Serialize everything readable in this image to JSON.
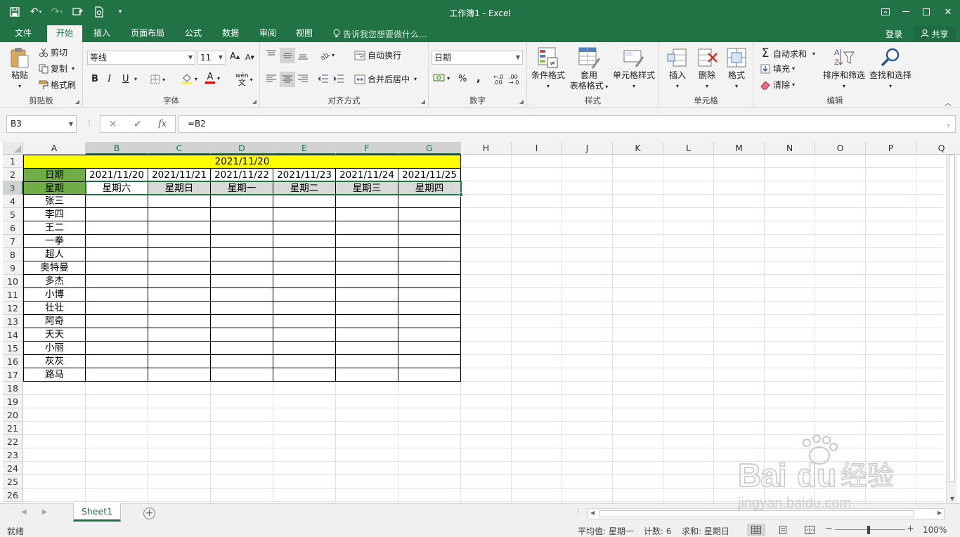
{
  "window": {
    "title": "工作簿1 - Excel"
  },
  "ribbon_tabs": [
    {
      "label": "文件"
    },
    {
      "label": "开始"
    },
    {
      "label": "插入"
    },
    {
      "label": "页面布局"
    },
    {
      "label": "公式"
    },
    {
      "label": "数据"
    },
    {
      "label": "审阅"
    },
    {
      "label": "视图"
    }
  ],
  "tell_me": "告诉我您想要做什么...",
  "account": {
    "login": "登录",
    "share": "共享"
  },
  "clipboard": {
    "paste": "粘贴",
    "cut": "剪切",
    "copy": "复制",
    "format_painter": "格式刷",
    "group_label": "剪贴板"
  },
  "font": {
    "name": "等线",
    "size": "11",
    "bold": "B",
    "italic": "I",
    "underline": "U",
    "group_label": "字体"
  },
  "alignment": {
    "wrap_text": "自动换行",
    "merge_center": "合并后居中",
    "group_label": "对齐方式"
  },
  "number": {
    "format": "日期",
    "percent": "%",
    "comma": ",",
    "group_label": "数字"
  },
  "styles": {
    "conditional": "条件格式",
    "as_table_1": "套用",
    "as_table_2": "表格格式",
    "cell_styles": "单元格样式",
    "group_label": "样式"
  },
  "cells": {
    "insert": "插入",
    "delete": "删除",
    "format": "格式",
    "group_label": "单元格"
  },
  "editing": {
    "autosum": "自动求和",
    "fill": "填充",
    "clear": "清除",
    "sort_filter": "排序和筛选",
    "find_select": "查找和选择",
    "group_label": "编辑"
  },
  "formula_bar": {
    "name_box": "B3",
    "cancel": "✕",
    "enter": "✔",
    "fx": "fx",
    "formula": "=B2"
  },
  "columns": [
    "A",
    "B",
    "C",
    "D",
    "E",
    "F",
    "G",
    "H",
    "I",
    "J",
    "K",
    "L",
    "M",
    "N",
    "O",
    "P",
    "Q"
  ],
  "rows": [
    "1",
    "2",
    "3",
    "4",
    "5",
    "6",
    "7",
    "8",
    "9",
    "10",
    "11",
    "12",
    "13",
    "14",
    "15",
    "16",
    "17",
    "18",
    "19",
    "20",
    "21",
    "22",
    "23",
    "24",
    "25",
    "26"
  ],
  "sheet": {
    "title_date": "2021/11/20",
    "a2": "日期",
    "a3": "星期",
    "dates": [
      "2021/11/20",
      "2021/11/21",
      "2021/11/22",
      "2021/11/23",
      "2021/11/24",
      "2021/11/25"
    ],
    "weekdays": [
      "星期六",
      "星期日",
      "星期一",
      "星期二",
      "星期三",
      "星期四"
    ],
    "names": [
      "张三",
      "李四",
      "王二",
      "一拳",
      "超人",
      "奥特曼",
      "多杰",
      "小博",
      "壮壮",
      "阿奇",
      "天天",
      "小丽",
      "灰灰",
      "路马"
    ]
  },
  "colors": {
    "excel_green": "#217346",
    "title_fill": "#ffff00",
    "header_fill": "#70ad47"
  },
  "sheet_tabs": {
    "active": "Sheet1",
    "add": "+"
  },
  "status": {
    "ready": "就绪",
    "average": "平均值: 星期一",
    "count": "计数: 6",
    "sum": "求和: 星期日",
    "zoom": "100%"
  },
  "watermark": {
    "text": "Baidu经验",
    "url": "jingyan.baidu.com"
  }
}
